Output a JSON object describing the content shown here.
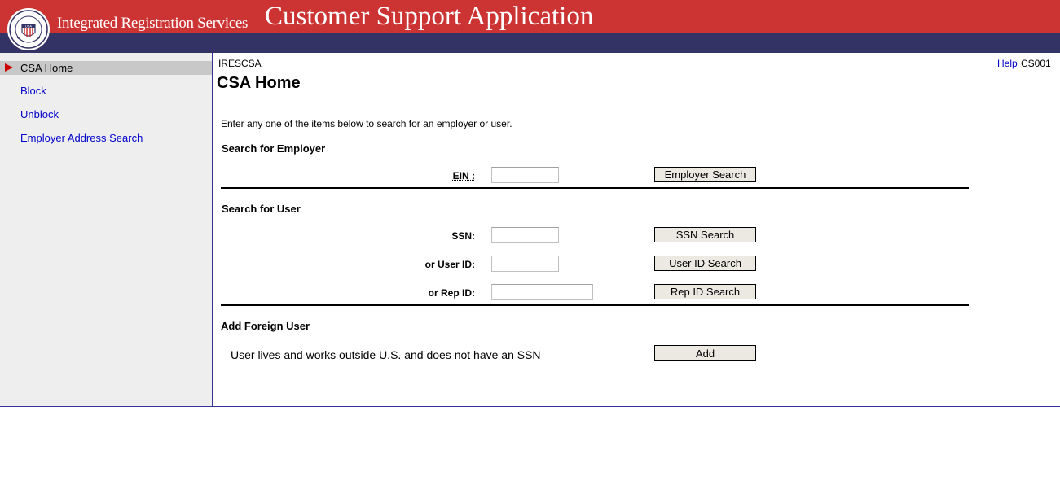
{
  "header": {
    "brand": "Integrated Registration Services",
    "app_title": "Customer Support Application",
    "seal_icon": "ssa-seal-icon",
    "seal_text": "USA",
    "colors": {
      "banner": "#cc3333",
      "strip": "#333366"
    }
  },
  "sidebar": {
    "items": [
      {
        "label": "CSA Home",
        "active": true
      },
      {
        "label": "Block",
        "active": false
      },
      {
        "label": "Unblock",
        "active": false
      },
      {
        "label": "Employer Address Search",
        "active": false
      }
    ]
  },
  "main": {
    "system_name": "IRESCSA",
    "help_label": "Help",
    "screen_id": "CS001",
    "page_title": "CSA Home",
    "intro": "Enter any one of the items below to search for an employer or user.",
    "employer": {
      "heading": "Search for Employer",
      "ein_label": "EIN :",
      "ein_value": "",
      "button": "Employer Search"
    },
    "user": {
      "heading": "Search for User",
      "ssn_label": "SSN:",
      "ssn_value": "",
      "ssn_button": "SSN Search",
      "userid_label": "or User ID:",
      "userid_value": "",
      "userid_button": "User ID Search",
      "repid_label": "or Rep ID:",
      "repid_value": "",
      "repid_button": "Rep ID Search"
    },
    "foreign": {
      "heading": "Add Foreign User",
      "text": "User lives and works outside U.S. and does not have an SSN",
      "button": "Add"
    }
  }
}
